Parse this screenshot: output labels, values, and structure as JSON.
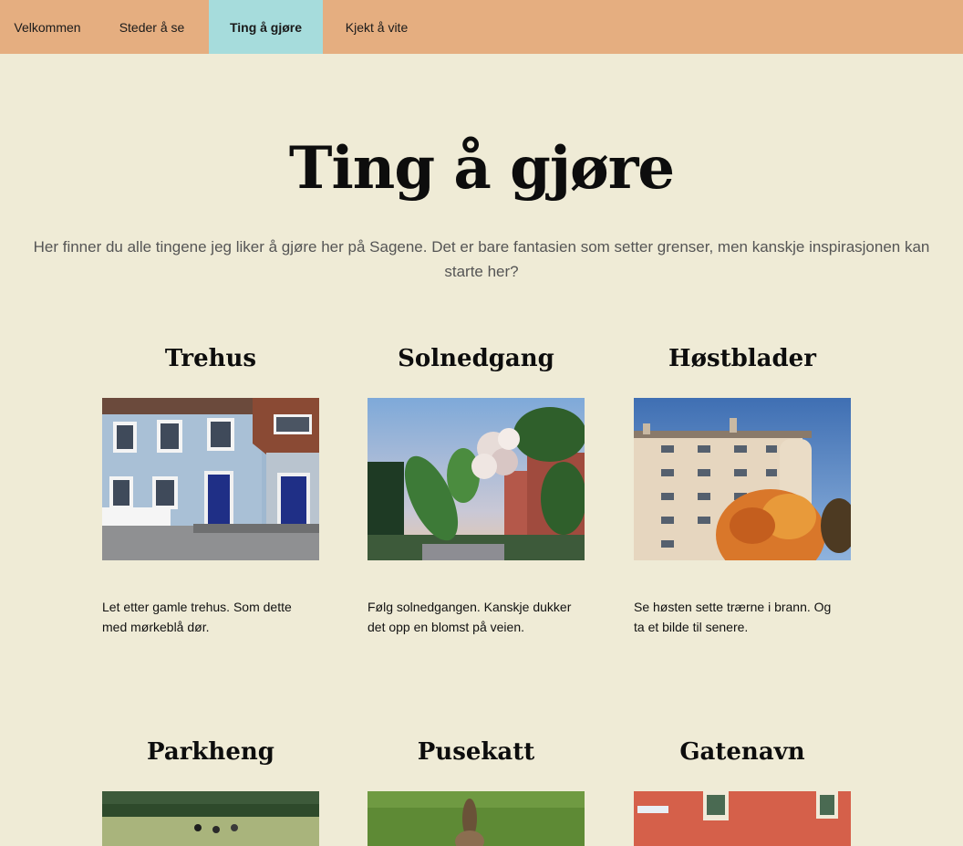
{
  "nav": {
    "items": [
      {
        "label": "Velkommen"
      },
      {
        "label": "Steder å se"
      },
      {
        "label": "Ting å gjøre"
      },
      {
        "label": "Kjekt å vite"
      }
    ],
    "active_index": 2,
    "background": "#e5ae80",
    "active_background": "#a6dcdc"
  },
  "main": {
    "title": "Ting å gjøre",
    "intro": "Her finner du alle tingene jeg liker å gjøre her på Sagene. Det er bare fantasien som setter grenser, men kanskje inspirasjonen kan starte her?"
  },
  "cards": [
    {
      "title": "Trehus",
      "text": "Let etter gamle trehus. Som dette med mørkeblå dør."
    },
    {
      "title": "Solnedgang",
      "text": "Følg solnedgangen. Kanskje dukker det opp en blomst på veien."
    },
    {
      "title": "Høstblader",
      "text": "Se høsten sette trærne i brann. Og ta et bilde til senere."
    },
    {
      "title": "Parkheng"
    },
    {
      "title": "Pusekatt"
    },
    {
      "title": "Gatenavn"
    }
  ],
  "page_background": "#efebd6"
}
